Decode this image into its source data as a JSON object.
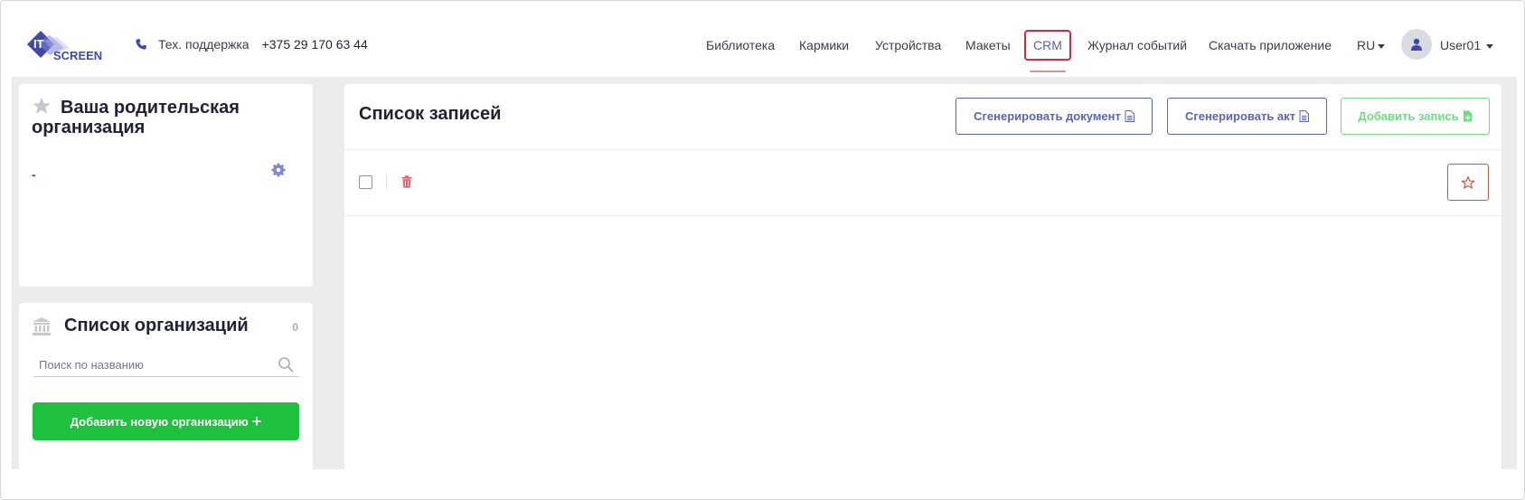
{
  "header": {
    "logo": {
      "line1": "IT",
      "line2": "SCREEN",
      "accent": "#3e4aa8"
    },
    "support_label": "Тех. поддержка",
    "support_phone": "+375 29 170 63 44",
    "nav": [
      {
        "label": "Библиотека"
      },
      {
        "label": "Кармики"
      },
      {
        "label": "Устройства"
      },
      {
        "label": "Макеты"
      },
      {
        "label": "CRM",
        "active": true
      },
      {
        "label": "Журнал событий"
      },
      {
        "label": "Скачать приложение"
      }
    ],
    "language": "RU",
    "user": "User01"
  },
  "parent_org": {
    "title": "Ваша родительская организация",
    "value": "-"
  },
  "orgs": {
    "title": "Список организаций",
    "count": "0",
    "search_placeholder": "Поиск по названию",
    "add_button": "Добавить новую организацию"
  },
  "records": {
    "title": "Список записей",
    "generate_document": "Сгенерировать документ",
    "generate_act": "Сгенерировать акт",
    "add_record": "Добавить запись"
  },
  "colors": {
    "accent": "#3e4aa8",
    "active_nav": "#e0243c",
    "green": "#1ec13e",
    "danger": "#e35d6a"
  }
}
